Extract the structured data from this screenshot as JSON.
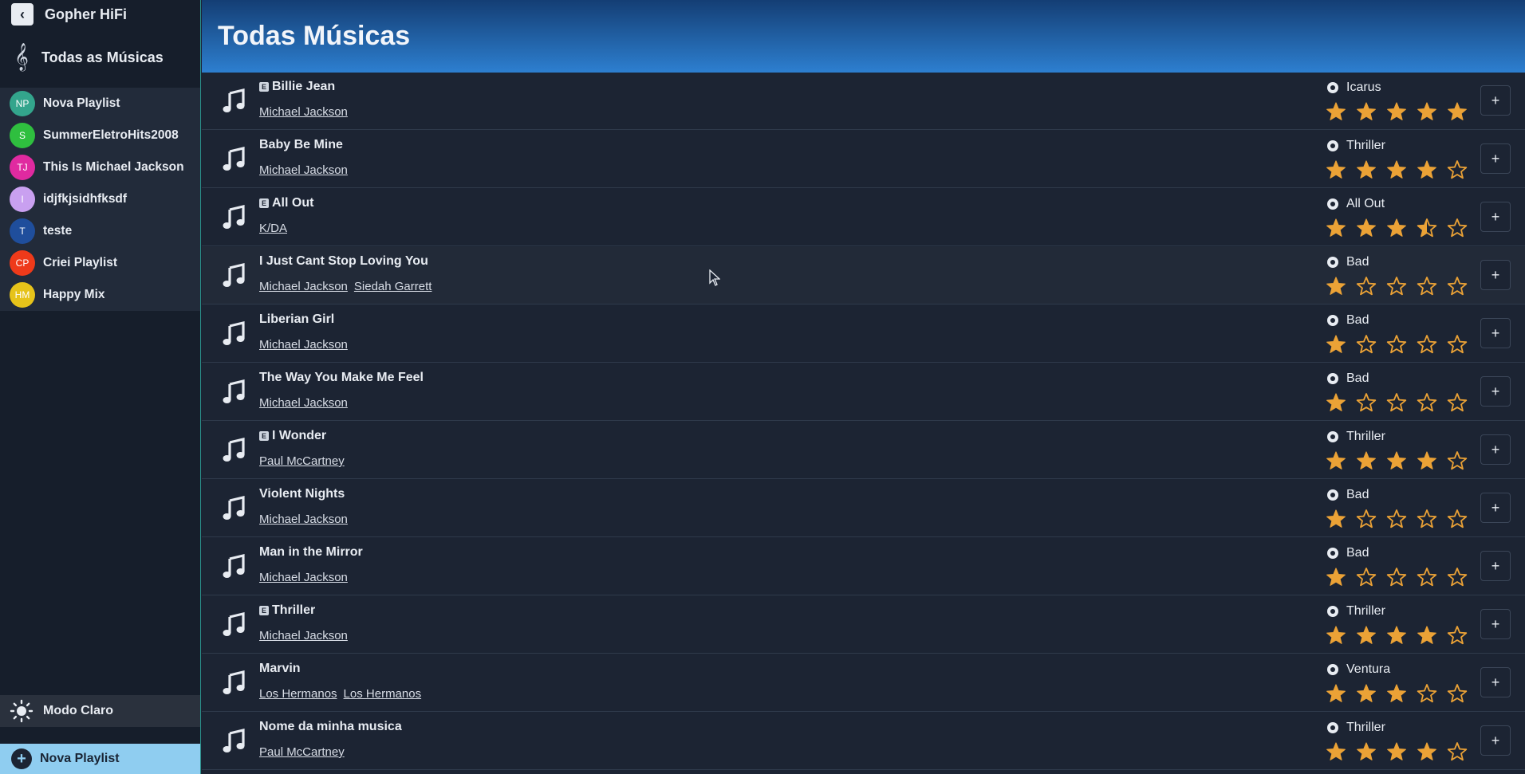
{
  "app": {
    "title": "Gopher HiFi",
    "accent": "#8fcdf0",
    "star_color": "#eba236"
  },
  "sidebar": {
    "all_songs_label": "Todas as Músicas",
    "playlists": [
      {
        "initials": "NP",
        "name": "Nova Playlist",
        "color": "#33a58c"
      },
      {
        "initials": "S",
        "name": "SummerEletroHits2008",
        "color": "#2fbf3f"
      },
      {
        "initials": "TJ",
        "name": "This Is Michael Jackson",
        "color": "#e02aa0"
      },
      {
        "initials": "I",
        "name": "idjfkjsidhfksdf",
        "color": "#c9a0f0"
      },
      {
        "initials": "T",
        "name": "teste",
        "color": "#1f4e9c"
      },
      {
        "initials": "CP",
        "name": "Criei Playlist",
        "color": "#ee3a1a"
      },
      {
        "initials": "HM",
        "name": "Happy Mix",
        "color": "#e6c31a"
      }
    ],
    "mode_label": "Modo Claro",
    "new_playlist_label": "Nova Playlist"
  },
  "main": {
    "title": "Todas Músicas",
    "add_label": "+",
    "songs": [
      {
        "title": "Billie Jean",
        "explicit": true,
        "artists": [
          "Michael Jackson"
        ],
        "album": "Icarus",
        "rating": 5
      },
      {
        "title": "Baby Be Mine",
        "explicit": false,
        "artists": [
          "Michael Jackson"
        ],
        "album": "Thriller",
        "rating": 4
      },
      {
        "title": "All Out",
        "explicit": true,
        "artists": [
          "K/DA"
        ],
        "album": "All Out",
        "rating": 3.5
      },
      {
        "title": "I Just Cant Stop Loving You",
        "explicit": false,
        "artists": [
          "Michael Jackson",
          "Siedah Garrett"
        ],
        "album": "Bad",
        "rating": 1
      },
      {
        "title": "Liberian Girl",
        "explicit": false,
        "artists": [
          "Michael Jackson"
        ],
        "album": "Bad",
        "rating": 1
      },
      {
        "title": "The Way You Make Me Feel",
        "explicit": false,
        "artists": [
          "Michael Jackson"
        ],
        "album": "Bad",
        "rating": 1
      },
      {
        "title": "I Wonder",
        "explicit": true,
        "artists": [
          "Paul McCartney"
        ],
        "album": "Thriller",
        "rating": 4
      },
      {
        "title": "Violent Nights",
        "explicit": false,
        "artists": [
          "Michael Jackson"
        ],
        "album": "Bad",
        "rating": 1
      },
      {
        "title": "Man in the Mirror",
        "explicit": false,
        "artists": [
          "Michael Jackson"
        ],
        "album": "Bad",
        "rating": 1
      },
      {
        "title": "Thriller",
        "explicit": true,
        "artists": [
          "Michael Jackson"
        ],
        "album": "Thriller",
        "rating": 4
      },
      {
        "title": "Marvin",
        "explicit": false,
        "artists": [
          "Los Hermanos",
          "Los Hermanos"
        ],
        "album": "Ventura",
        "rating": 3
      },
      {
        "title": "Nome da minha musica",
        "explicit": false,
        "artists": [
          "Paul McCartney"
        ],
        "album": "Thriller",
        "rating": 4
      }
    ]
  }
}
